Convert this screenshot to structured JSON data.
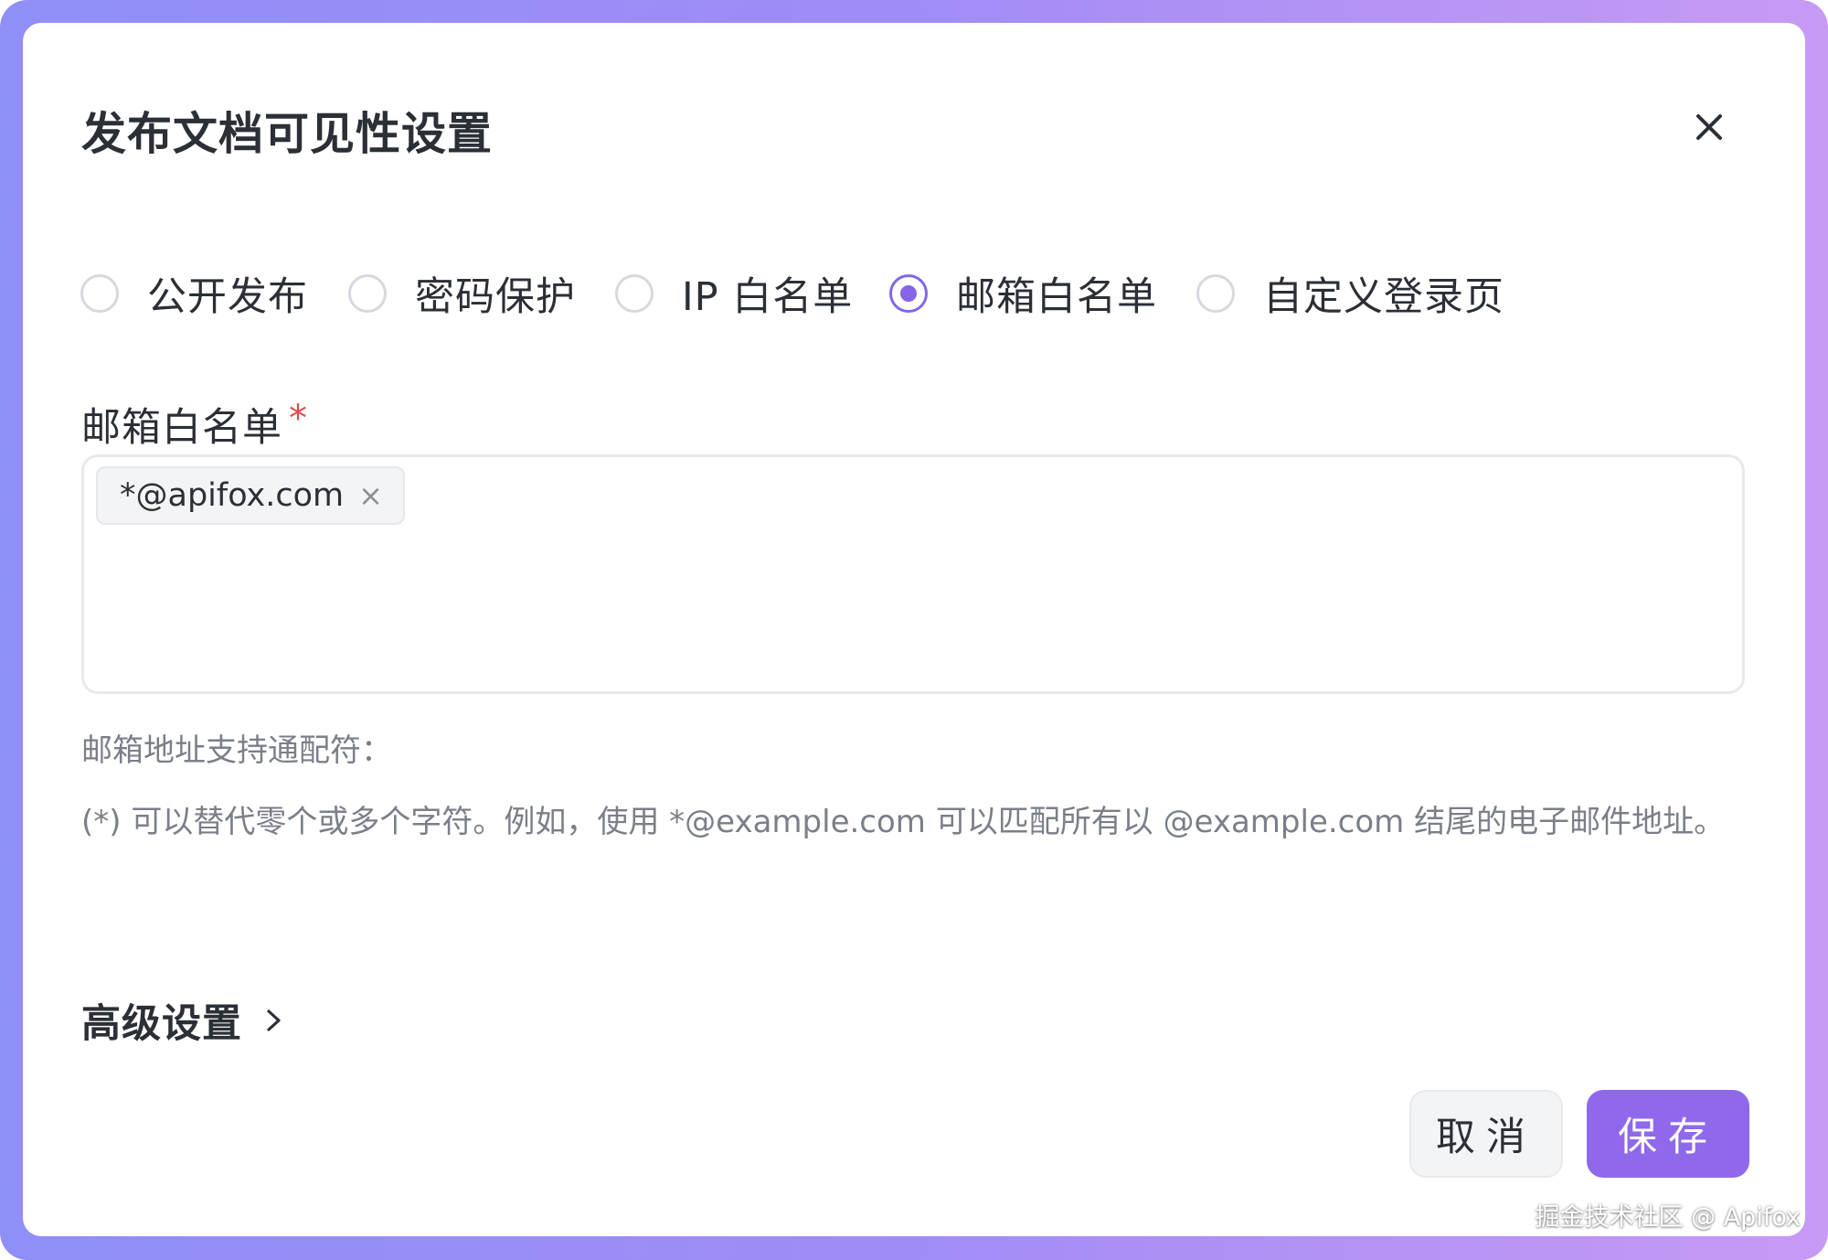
{
  "dialog": {
    "title": "发布文档可见性设置",
    "close_icon": "close-icon"
  },
  "visibility_options": [
    {
      "label": "公开发布",
      "checked": false
    },
    {
      "label": "密码保护",
      "checked": false
    },
    {
      "label": "IP 白名单",
      "checked": false
    },
    {
      "label": "邮箱白名单",
      "checked": true
    },
    {
      "label": "自定义登录页",
      "checked": false
    }
  ],
  "email_whitelist": {
    "label": "邮箱白名单",
    "required_mark": "*",
    "tags": [
      "*@apifox.com"
    ],
    "tag_remove_icon": "×"
  },
  "help": {
    "title": "邮箱地址支持通配符：",
    "body": "(*) 可以替代零个或多个字符。例如，使用 *@example.com 可以匹配所有以 @example.com 结尾的电子邮件地址。"
  },
  "advanced": {
    "label": "高级设置",
    "icon": "chevron-right-icon"
  },
  "footer": {
    "cancel_label": "取消",
    "save_label": "保存"
  },
  "watermark": "掘金技术社区 @ Apifox",
  "colors": {
    "accent": "#8566e6",
    "save_button": "#8f68eb",
    "required": "#e5484d",
    "frame_left": "#8f8ff8",
    "frame_right": "#c79af4"
  }
}
